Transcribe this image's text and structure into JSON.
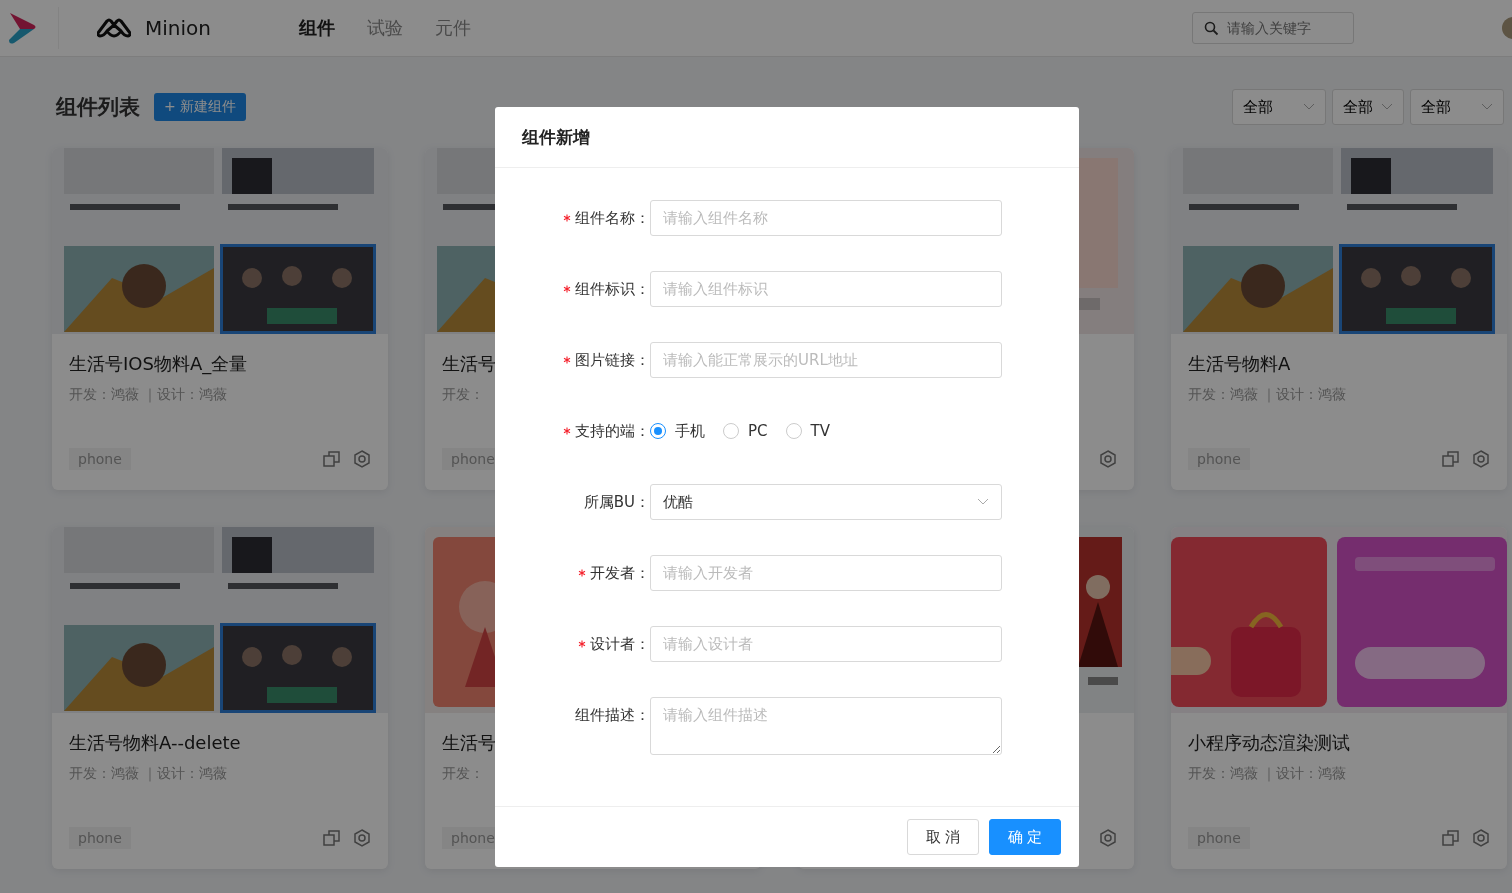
{
  "header": {
    "brand": "Minion",
    "nav": [
      {
        "label": "组件",
        "selected": true
      },
      {
        "label": "试验",
        "selected": false
      },
      {
        "label": "元件",
        "selected": false
      }
    ],
    "search": {
      "placeholder": "请输入关键字"
    }
  },
  "toolbar": {
    "title": "组件列表",
    "new_button": "+ 新建组件",
    "filters": [
      "全部",
      "全部",
      "全部"
    ]
  },
  "cards": [
    {
      "kind": "full",
      "title": "生活号IOS物料A_全量",
      "meta": "开发：鸿薇 ｜设计：鸿薇",
      "tag": "phone"
    },
    {
      "kind": "left-edge",
      "title": "生活号",
      "meta": "开发：",
      "tag": "phone"
    },
    {
      "kind": "right-edge"
    },
    {
      "kind": "full",
      "title": "生活号物料A",
      "meta": "开发：鸿薇 ｜设计：鸿薇",
      "tag": "phone"
    },
    {
      "kind": "full",
      "title": "生活号物料A--delete",
      "meta": "开发：鸿薇 ｜设计：鸿薇",
      "tag": "phone"
    },
    {
      "kind": "left-edge",
      "title": "生活号",
      "meta": "开发：",
      "tag": "phone"
    },
    {
      "kind": "right-edge"
    },
    {
      "kind": "full",
      "title": "小程序动态渲染测试",
      "meta": "开发：鸿薇 ｜设计：鸿薇",
      "tag": "phone"
    }
  ],
  "modal": {
    "title": "组件新增",
    "fields": [
      {
        "kind": "input",
        "label": "组件名称：",
        "required": true,
        "placeholder": "请输入组件名称"
      },
      {
        "kind": "input",
        "label": "组件标识：",
        "required": true,
        "placeholder": "请输入组件标识"
      },
      {
        "kind": "input",
        "label": "图片链接：",
        "required": true,
        "placeholder": "请输入能正常展示的URL地址"
      },
      {
        "kind": "radio",
        "label": "支持的端：",
        "required": true,
        "options": [
          {
            "label": "手机",
            "selected": true
          },
          {
            "label": "PC",
            "selected": false
          },
          {
            "label": "TV",
            "selected": false
          }
        ]
      },
      {
        "kind": "select",
        "label": "所属BU：",
        "required": false,
        "value": "优酷"
      },
      {
        "kind": "input",
        "label": "开发者：",
        "required": true,
        "placeholder": "请输入开发者"
      },
      {
        "kind": "input",
        "label": "设计者：",
        "required": true,
        "placeholder": "请输入设计者"
      },
      {
        "kind": "textarea",
        "label": "组件描述：",
        "required": false,
        "placeholder": "请输入组件描述"
      }
    ],
    "buttons": [
      {
        "label": "取 消",
        "kind": "secondary"
      },
      {
        "label": "确 定",
        "kind": "primary"
      }
    ]
  }
}
